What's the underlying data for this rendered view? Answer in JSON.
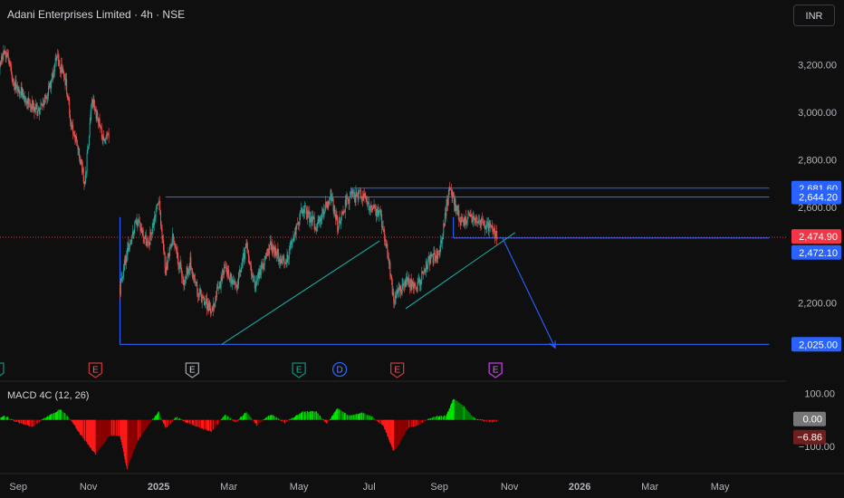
{
  "header": {
    "title": "Adani Enterprises Limited · 4h · NSE",
    "currency": "INR"
  },
  "chart_data": {
    "type": "candlestick",
    "title": "Adani Enterprises Limited · 4h · NSE",
    "price_axis": {
      "ylim": [
        1950,
        3320
      ],
      "ticks": [
        {
          "v": 3200,
          "t": "3,200.00"
        },
        {
          "v": 3000,
          "t": "3,000.00"
        },
        {
          "v": 2800,
          "t": "2,800.00"
        },
        {
          "v": 2600,
          "t": "2,600.00"
        },
        {
          "v": 2200,
          "t": "2,200.00"
        }
      ],
      "labels": [
        {
          "v": 2681.6,
          "t": "2,681.60",
          "color": "#2962ff"
        },
        {
          "v": 2644.2,
          "t": "2,644.20",
          "color": "#2962ff"
        },
        {
          "v": 2474.9,
          "t": "2,474.90",
          "color": "#f23645"
        },
        {
          "v": 2472.1,
          "t": "2,472.10",
          "color": "#2962ff"
        },
        {
          "v": 2025.0,
          "t": "2,025.00",
          "color": "#2962ff"
        }
      ]
    },
    "time_axis": {
      "ticks": [
        {
          "m": 0.5,
          "t": "Sep",
          "bold": false
        },
        {
          "m": 1.5,
          "t": "Nov",
          "bold": false
        },
        {
          "m": 2.5,
          "t": "2025",
          "bold": true
        },
        {
          "m": 3.5,
          "t": "Mar",
          "bold": false
        },
        {
          "m": 4.5,
          "t": "May",
          "bold": false
        },
        {
          "m": 5.5,
          "t": "Jul",
          "bold": false
        },
        {
          "m": 6.5,
          "t": "Sep",
          "bold": false
        },
        {
          "m": 7.5,
          "t": "Nov",
          "bold": false
        },
        {
          "m": 8.5,
          "t": "2026",
          "bold": true
        },
        {
          "m": 9.5,
          "t": "Mar",
          "bold": false
        },
        {
          "m": 10.5,
          "t": "May",
          "bold": false
        }
      ]
    },
    "price_keypoints": [
      [
        0,
        3100
      ],
      [
        0.2,
        3180
      ],
      [
        0.3,
        3270
      ],
      [
        0.45,
        3120
      ],
      [
        0.6,
        3060
      ],
      [
        0.8,
        3000
      ],
      [
        0.95,
        3110
      ],
      [
        1.05,
        3230
      ],
      [
        1.18,
        3120
      ],
      [
        1.25,
        2950
      ],
      [
        1.35,
        2850
      ],
      [
        1.45,
        2700
      ],
      [
        1.55,
        3050
      ],
      [
        1.7,
        2900
      ],
      [
        1.8,
        2890
      ],
      [
        1.95,
        2260
      ],
      [
        2.05,
        2420
      ],
      [
        2.2,
        2550
      ],
      [
        2.35,
        2440
      ],
      [
        2.5,
        2640
      ],
      [
        2.6,
        2330
      ],
      [
        2.7,
        2470
      ],
      [
        2.85,
        2290
      ],
      [
        2.95,
        2370
      ],
      [
        3.05,
        2250
      ],
      [
        3.25,
        2170
      ],
      [
        3.45,
        2350
      ],
      [
        3.6,
        2260
      ],
      [
        3.75,
        2440
      ],
      [
        3.85,
        2270
      ],
      [
        4.1,
        2440
      ],
      [
        4.3,
        2360
      ],
      [
        4.55,
        2600
      ],
      [
        4.75,
        2520
      ],
      [
        4.95,
        2650
      ],
      [
        5.05,
        2520
      ],
      [
        5.2,
        2640
      ],
      [
        5.4,
        2650
      ],
      [
        5.5,
        2600
      ],
      [
        5.65,
        2580
      ],
      [
        5.75,
        2440
      ],
      [
        5.85,
        2210
      ],
      [
        6.05,
        2300
      ],
      [
        6.15,
        2250
      ],
      [
        6.35,
        2380
      ],
      [
        6.5,
        2400
      ],
      [
        6.65,
        2690
      ],
      [
        6.8,
        2540
      ],
      [
        7.0,
        2560
      ],
      [
        7.2,
        2520
      ],
      [
        7.32,
        2475
      ]
    ],
    "drawings": {
      "lines": [
        {
          "m1": 1.95,
          "p1": 2025,
          "m2": 11.2,
          "p2": 2025
        },
        {
          "m1": 1.95,
          "p1": 2025,
          "m2": 1.95,
          "p2": 2560
        },
        {
          "m1": 2.6,
          "p1": 2644.2,
          "m2": 11.2,
          "p2": 2644.2
        },
        {
          "m1": 5.25,
          "p1": 2681.6,
          "m2": 11.2,
          "p2": 2681.6
        },
        {
          "m1": 5.25,
          "p1": 2681.6,
          "m2": 5.25,
          "p2": 2640
        },
        {
          "m1": 6.7,
          "p1": 2472.1,
          "m2": 11.2,
          "p2": 2472.1
        },
        {
          "m1": 6.7,
          "p1": 2472.1,
          "m2": 6.7,
          "p2": 2560
        }
      ],
      "trendlines": [
        {
          "m1": 3.4,
          "p1": 2025,
          "m2": 5.65,
          "p2": 2460
        },
        {
          "m1": 6.02,
          "p1": 2175,
          "m2": 7.58,
          "p2": 2495
        }
      ],
      "arrow": {
        "m1": 7.4,
        "p1": 2472,
        "m2": 8.15,
        "p2": 2010
      }
    },
    "events": [
      {
        "m": 0.2,
        "label": "E",
        "style": "green"
      },
      {
        "m": 1.6,
        "label": "E",
        "style": "red"
      },
      {
        "m": 2.98,
        "label": "E",
        "style": "gray"
      },
      {
        "m": 4.5,
        "label": "E",
        "style": "green"
      },
      {
        "m": 5.08,
        "label": "D",
        "style": "blue"
      },
      {
        "m": 5.9,
        "label": "E",
        "style": "red"
      },
      {
        "m": 7.3,
        "label": "E",
        "style": "purple"
      }
    ],
    "macd": {
      "name": "MACD 4C (12, 26)",
      "ylim": [
        -200,
        150
      ],
      "ticks": [
        {
          "v": 100,
          "t": "100.00"
        },
        {
          "v": -100,
          "t": "−100.00"
        }
      ],
      "value_labels": [
        {
          "v": 0,
          "t": "0.00",
          "color": "#777777"
        },
        {
          "v": -6.86,
          "t": "−6.86",
          "color": "#6f1d1d"
        }
      ],
      "keypoints": [
        [
          0,
          -20
        ],
        [
          0.3,
          15
        ],
        [
          0.5,
          -10
        ],
        [
          0.7,
          -25
        ],
        [
          0.9,
          10
        ],
        [
          1.1,
          40
        ],
        [
          1.25,
          0
        ],
        [
          1.4,
          -60
        ],
        [
          1.6,
          -130
        ],
        [
          1.8,
          -60
        ],
        [
          1.95,
          -60
        ],
        [
          2.05,
          -185
        ],
        [
          2.2,
          -80
        ],
        [
          2.35,
          -20
        ],
        [
          2.5,
          30
        ],
        [
          2.6,
          -30
        ],
        [
          2.75,
          10
        ],
        [
          2.9,
          -10
        ],
        [
          3.05,
          -25
        ],
        [
          3.25,
          -45
        ],
        [
          3.45,
          20
        ],
        [
          3.6,
          -10
        ],
        [
          3.75,
          30
        ],
        [
          3.9,
          -20
        ],
        [
          4.1,
          20
        ],
        [
          4.3,
          -10
        ],
        [
          4.55,
          30
        ],
        [
          4.75,
          30
        ],
        [
          4.9,
          -15
        ],
        [
          5.05,
          45
        ],
        [
          5.2,
          15
        ],
        [
          5.4,
          25
        ],
        [
          5.55,
          10
        ],
        [
          5.7,
          -20
        ],
        [
          5.85,
          -120
        ],
        [
          5.95,
          -80
        ],
        [
          6.05,
          -30
        ],
        [
          6.2,
          -20
        ],
        [
          6.35,
          5
        ],
        [
          6.5,
          15
        ],
        [
          6.6,
          15
        ],
        [
          6.7,
          80
        ],
        [
          6.85,
          50
        ],
        [
          7.0,
          5
        ],
        [
          7.2,
          -7
        ],
        [
          7.32,
          -7
        ]
      ]
    }
  }
}
